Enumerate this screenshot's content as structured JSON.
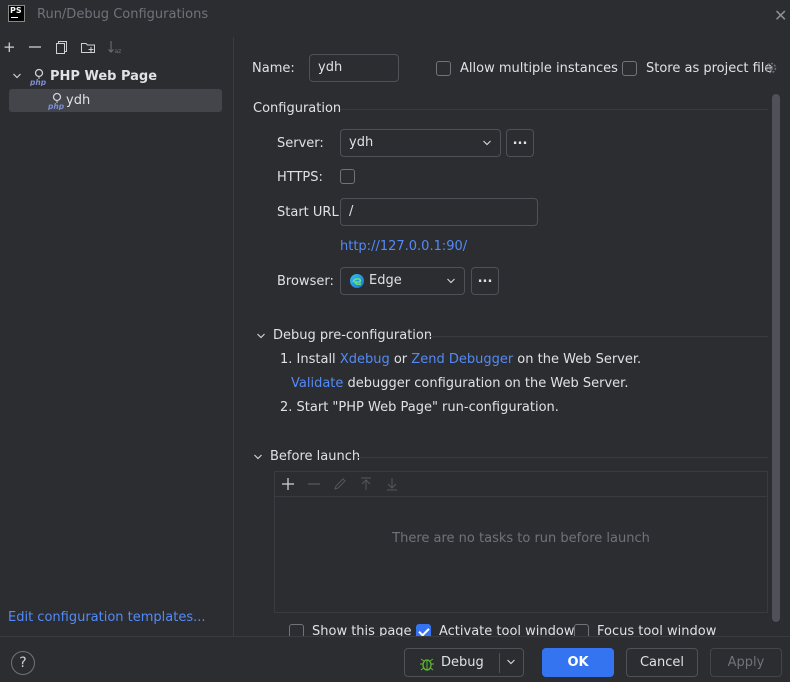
{
  "window": {
    "title": "Run/Debug Configurations",
    "app_icon_text": "PS"
  },
  "left_toolbar": {
    "add": "+",
    "remove": "—",
    "copy": "⧉",
    "folder": "📁",
    "sort": "↓"
  },
  "tree": {
    "group_label": "PHP Web Page",
    "items": [
      {
        "label": "ydh"
      }
    ]
  },
  "edit_templates_link": "Edit configuration templates...",
  "form": {
    "name_label": "Name:",
    "name_value": "ydh",
    "allow_multiple_label": "Allow multiple instances",
    "store_as_project_label": "Store as project file",
    "configuration_title": "Configuration",
    "server_label": "Server:",
    "server_value": "ydh",
    "https_label": "HTTPS:",
    "start_url_label": "Start URL:",
    "start_url_value": "/",
    "resolved_url": "http://127.0.0.1:90/",
    "browser_label": "Browser:",
    "browser_value": "Edge",
    "ellipsis": "..."
  },
  "debug_preconfig": {
    "title": "Debug pre-configuration",
    "step1_prefix": "1. Install ",
    "step1_link1": "Xdebug",
    "step1_or": " or ",
    "step1_link2": "Zend Debugger",
    "step1_suffix": " on the Web Server.",
    "validate_link": "Validate",
    "validate_suffix": " debugger configuration on the Web Server.",
    "step2": "2. Start \"PHP Web Page\" run-configuration."
  },
  "before_launch": {
    "title": "Before launch",
    "empty_text": "There are no tasks to run before launch"
  },
  "bottom_options": {
    "show_this_page": "Show this page",
    "activate_tool_window": "Activate tool window",
    "focus_tool_window": "Focus tool window",
    "activate_checked": true
  },
  "footer": {
    "help": "?",
    "debug_label": "Debug",
    "ok_label": "OK",
    "cancel_label": "Cancel",
    "apply_label": "Apply"
  },
  "colors": {
    "background": "#2b2d30",
    "accent": "#3574f0",
    "link": "#548af7",
    "border": "#4e5157"
  }
}
